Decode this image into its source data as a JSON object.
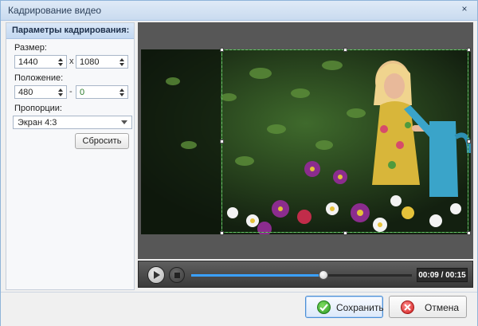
{
  "window": {
    "title": "Кадрирование видео",
    "close_glyph": "×"
  },
  "panel": {
    "header": "Параметры кадрирования:",
    "size": {
      "label": "Размер:",
      "width": "1440",
      "separator": "x",
      "height": "1080"
    },
    "position": {
      "label": "Положение:",
      "x": "480",
      "separator": "-",
      "y": "0"
    },
    "aspect": {
      "label": "Пропорции:",
      "selected": "Экран 4:3"
    },
    "reset_label": "Сбросить"
  },
  "player": {
    "time": "00:09 / 00:15",
    "progress": 0.6,
    "accent_color": "#3aa0ff"
  },
  "buttons": {
    "save_label": "Сохранить",
    "cancel_label": "Отмена"
  },
  "icons": {
    "save": "check-icon",
    "cancel": "cancel-icon",
    "play": "play-icon",
    "stop": "stop-icon"
  }
}
